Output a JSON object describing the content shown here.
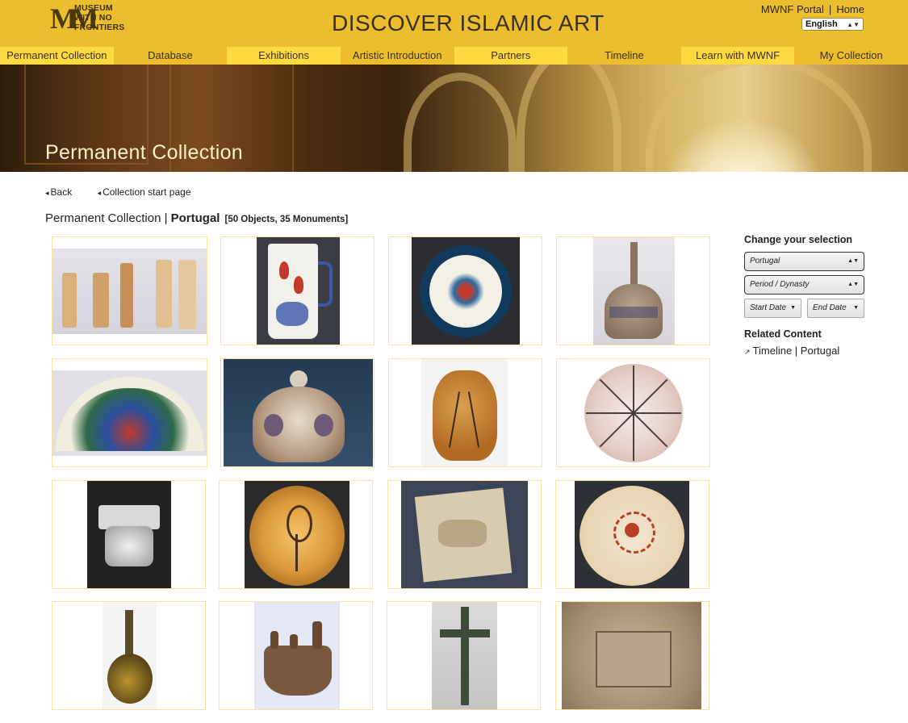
{
  "header": {
    "logo_lines": [
      "MUSEUM",
      "WITH NO",
      "FRONTIERS"
    ],
    "logo_mark": "MM",
    "site_title": "DISCOVER ISLAMIC ART",
    "portal_link": "MWNF Portal",
    "separator": "|",
    "home_link": "Home",
    "language": "English"
  },
  "nav": {
    "items": [
      {
        "label": "Permanent Collection",
        "style": "light"
      },
      {
        "label": "Database",
        "style": "dark"
      },
      {
        "label": "Exhibitions",
        "style": "light"
      },
      {
        "label": "Artistic Introduction",
        "style": "dark"
      },
      {
        "label": "Partners",
        "style": "light"
      },
      {
        "label": "Timeline",
        "style": "dark"
      },
      {
        "label": "Learn with MWNF",
        "style": "light"
      },
      {
        "label": "My Collection",
        "style": "dark"
      }
    ]
  },
  "banner": {
    "title": "Permanent Collection"
  },
  "links": {
    "back": "Back",
    "start": "Collection start page"
  },
  "collection": {
    "prefix": "Permanent Collection | ",
    "country": "Portugal",
    "count": "[50 Objects, 35 Monuments]"
  },
  "sidebar": {
    "title": "Change your selection",
    "country_select": "Portugal",
    "period_select": "Period / Dynasty",
    "start_date": "Start Date",
    "end_date": "End Date",
    "related_title": "Related Content",
    "related_link": "Timeline | Portugal"
  },
  "colors": {
    "header_bg": "#ecbd2c",
    "nav_light": "#ffd940",
    "banner_title": "#fff3c4"
  }
}
